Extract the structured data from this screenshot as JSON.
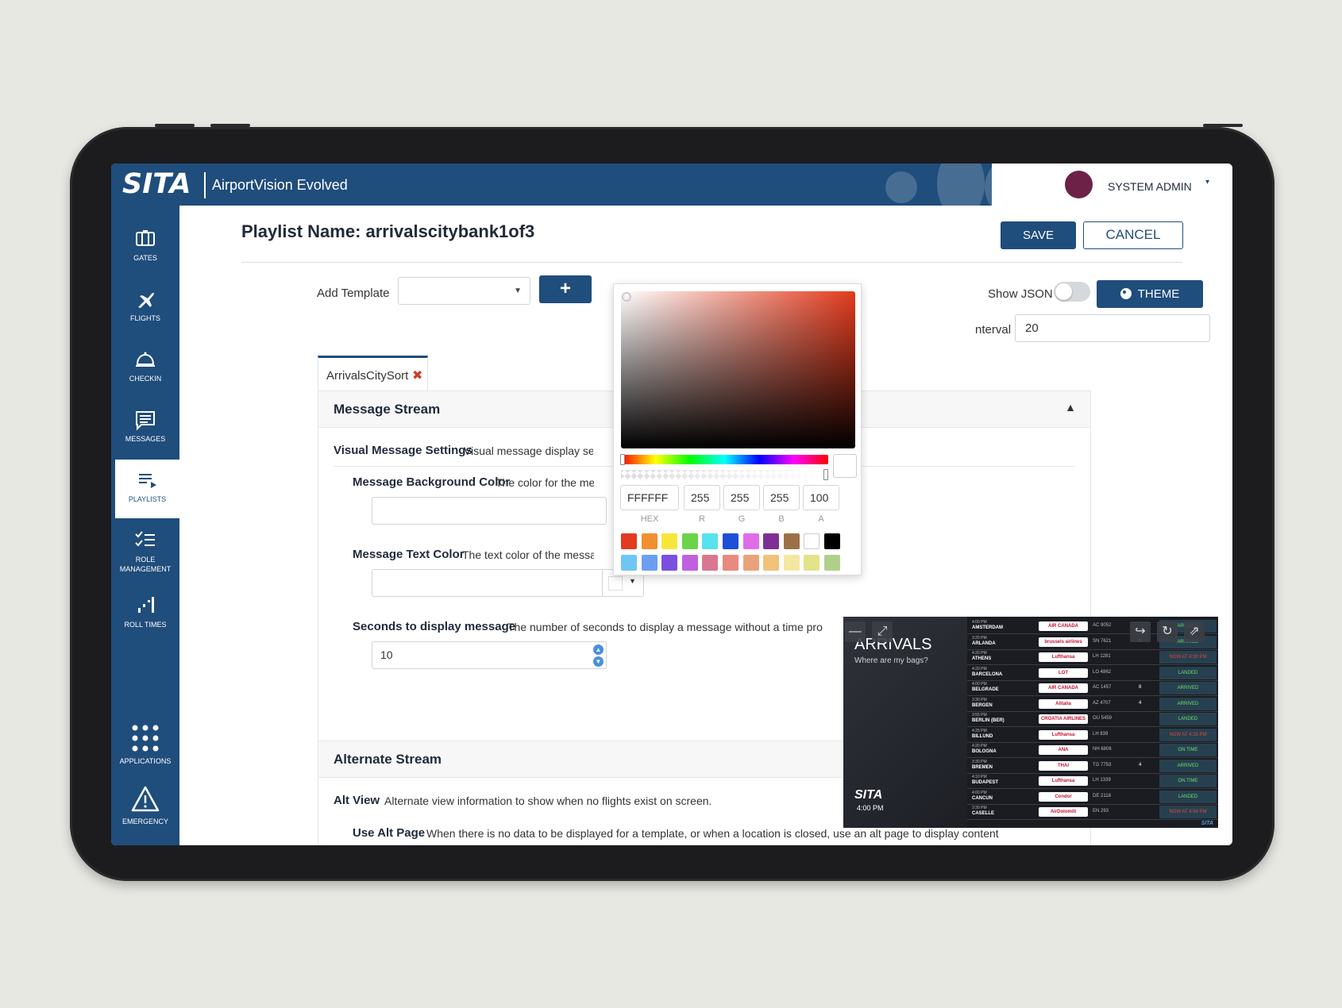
{
  "header": {
    "logo": "SITA",
    "product": "AirportVision Evolved",
    "user": "SYSTEM ADMIN",
    "user_caret": "▾"
  },
  "sidebar": {
    "items": [
      {
        "label": "GATES",
        "icon": "gates-icon"
      },
      {
        "label": "FLIGHTS",
        "icon": "plane-icon"
      },
      {
        "label": "CHECKIN",
        "icon": "bell-icon"
      },
      {
        "label": "MESSAGES",
        "icon": "message-icon"
      },
      {
        "label": "PLAYLISTS",
        "icon": "playlist-icon",
        "active": true
      },
      {
        "label": "ROLE MANAGEMENT",
        "icon": "checklist-icon"
      },
      {
        "label": "ROLL TIMES",
        "icon": "roll-times-icon"
      },
      {
        "label": "APPLICATIONS",
        "icon": "grid-icon"
      },
      {
        "label": "EMERGENCY",
        "icon": "warning-icon"
      }
    ]
  },
  "page": {
    "title": "Playlist Name: arrivalscitybank1of3",
    "save_label": "SAVE",
    "cancel_label": "CANCEL",
    "add_template_label": "Add Template",
    "add_template_value": "",
    "plus_label": "+",
    "show_json_label": "Show JSON",
    "show_json_on": false,
    "theme_label": "THEME",
    "interval_label": "nterval",
    "interval_value": "20"
  },
  "tabs": [
    {
      "label": "ArrivalsCitySort",
      "close": "✖"
    }
  ],
  "message_stream": {
    "title": "Message Stream",
    "collapse": "⌃",
    "visual_settings_label": "Visual Message Settings",
    "visual_settings_desc": "Visual message display set",
    "bg_color_label": "Message Background Color",
    "bg_color_desc": "The color for the me",
    "bg_color_value": "",
    "text_color_label": "Message Text Color",
    "text_color_desc": "The text color of the messag",
    "text_color_value": "",
    "seconds_label": "Seconds to display message",
    "seconds_desc": "The number of seconds to display a message without a time pro",
    "seconds_value": "10"
  },
  "alternate_stream": {
    "title": "Alternate Stream",
    "alt_view_label": "Alt View",
    "alt_view_desc": "Alternate view information to show when no flights exist on screen.",
    "use_alt_label": "Use Alt Page",
    "use_alt_desc": "When there is no data to be displayed for a template, or when a location is closed, use an alt page to display content"
  },
  "color_picker": {
    "hex": "FFFFFF",
    "r": "255",
    "g": "255",
    "b": "255",
    "a": "100",
    "hex_label": "HEX",
    "r_label": "R",
    "g_label": "G",
    "b_label": "B",
    "a_label": "A",
    "hue_position": 0,
    "alpha_position": 1,
    "swatches_row1": [
      "#e23b1f",
      "#f09030",
      "#f7e63a",
      "#6cd34a",
      "#58e1ef",
      "#1e4fd8",
      "#e06de8",
      "#7e2f95",
      "#9c7046",
      "#ffffff",
      "#000000"
    ],
    "swatches_row2": [
      "#70c6f2",
      "#6c9ff0",
      "#7a4fe0",
      "#c060e0",
      "#d87890",
      "#e88a80",
      "#eaa27a",
      "#f0c27a",
      "#f4e7a0",
      "#e2e48a",
      "#b0d08a"
    ]
  },
  "preview": {
    "title": "ARRIVALS",
    "subtitle": "Where are my bags?",
    "logo": "SITA",
    "time": "4:00 PM",
    "brand": "SITA",
    "rows": [
      {
        "time": "4:00 PM",
        "city": "AMSTERDAM",
        "airline": "AIR CANADA",
        "flight": "AC 9052",
        "belt": "",
        "status": "ARRIVED",
        "status_color": "#6be06b"
      },
      {
        "time": "3:20 PM",
        "city": "ARLANDA",
        "airline": "brussels airlines",
        "flight": "SN 7621",
        "belt": "8",
        "status": "ARRIVED",
        "status_color": "#6be06b"
      },
      {
        "time": "4:20 PM",
        "city": "ATHENS",
        "airline": "Lufthansa",
        "flight": "LH 1281",
        "belt": "",
        "status": "NOW AT 4:30 PM",
        "status_color": "#e0463a"
      },
      {
        "time": "4:20 PM",
        "city": "BARCELONA",
        "airline": "LOT",
        "flight": "LO 4862",
        "belt": "",
        "status": "LANDED",
        "status_color": "#6be06b"
      },
      {
        "time": "4:00 PM",
        "city": "BELGRADE",
        "airline": "AIR CANADA",
        "flight": "AC 1457",
        "belt": "8",
        "status": "ARRIVED",
        "status_color": "#6be06b"
      },
      {
        "time": "3:30 PM",
        "city": "BERGEN",
        "airline": "Alitalia",
        "flight": "AZ 4707",
        "belt": "4",
        "status": "ARRIVED",
        "status_color": "#6be06b"
      },
      {
        "time": "3:55 PM",
        "city": "BERLIN (BER)",
        "airline": "CROATIA AIRLINES",
        "flight": "OU 5459",
        "belt": "",
        "status": "LANDED",
        "status_color": "#6be06b"
      },
      {
        "time": "4:25 PM",
        "city": "BILLUND",
        "airline": "Lufthansa",
        "flight": "LH 839",
        "belt": "",
        "status": "NOW AT 4:35 PM",
        "status_color": "#e0463a"
      },
      {
        "time": "4:20 PM",
        "city": "BOLOGNA",
        "airline": "ANA",
        "flight": "NH 6806",
        "belt": "",
        "status": "ON TIME",
        "status_color": "#6be06b"
      },
      {
        "time": "3:30 PM",
        "city": "BREMEN",
        "airline": "THAI",
        "flight": "TG 7753",
        "belt": "4",
        "status": "ARRIVED",
        "status_color": "#6be06b"
      },
      {
        "time": "4:10 PM",
        "city": "BUDAPEST",
        "airline": "Lufthansa",
        "flight": "LH 1339",
        "belt": "",
        "status": "ON TIME",
        "status_color": "#6be06b"
      },
      {
        "time": "4:00 PM",
        "city": "CANCUN",
        "airline": "Condor",
        "flight": "DE 2118",
        "belt": "",
        "status": "LANDED",
        "status_color": "#6be06b"
      },
      {
        "time": "3:30 PM",
        "city": "CASELLE",
        "airline": "AirDolomiti",
        "flight": "EN 293",
        "belt": "",
        "status": "NOW AT 4:54 PM",
        "status_color": "#e0463a"
      }
    ]
  }
}
